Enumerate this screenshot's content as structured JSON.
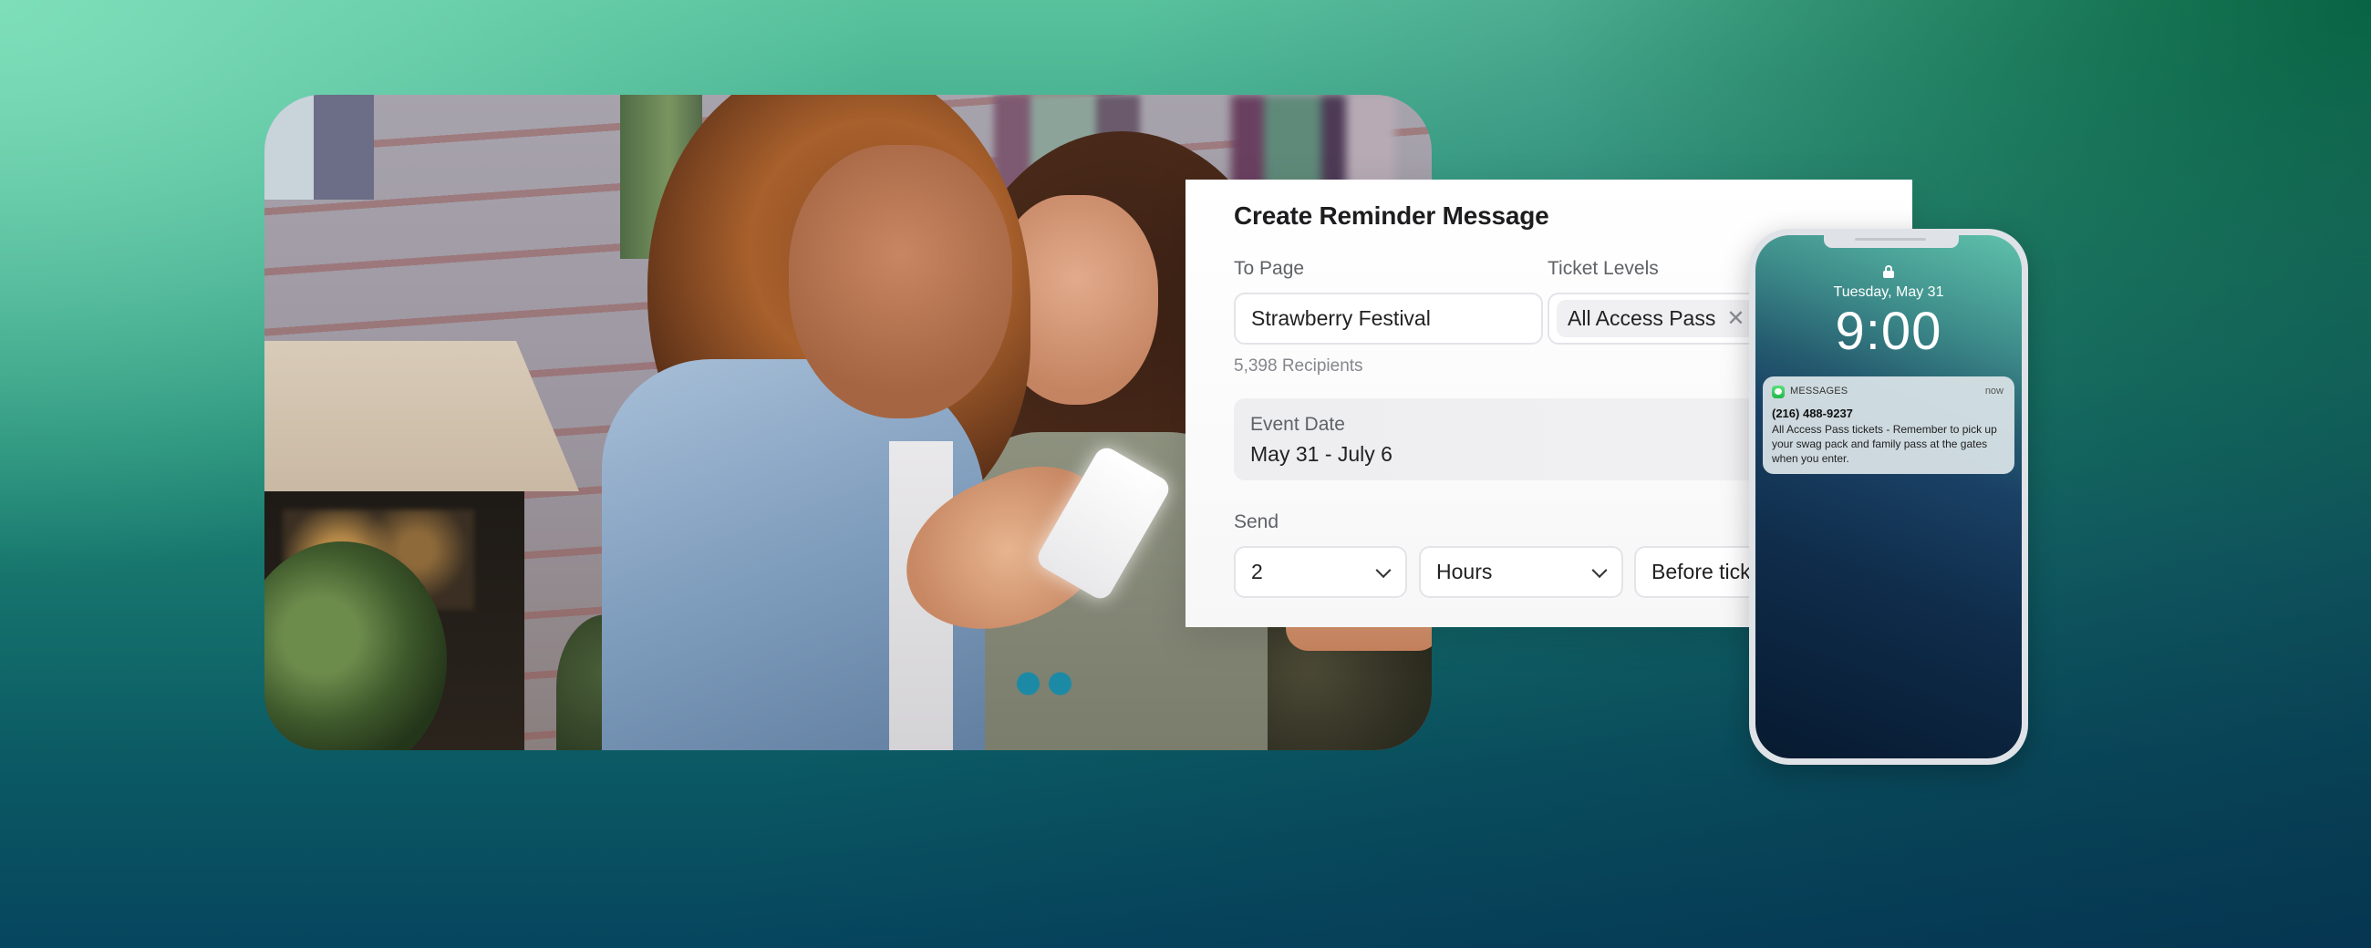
{
  "colors": {
    "bg_top_left": "#7EDEBA",
    "bg_top_right": "#0A8C42",
    "bg_bottom_left": "#0B5A64",
    "bg_bottom_right": "#06344E",
    "card_bg": "#FFFFFF",
    "messages_green": "#21B84A"
  },
  "photo": {
    "description": "Two smiling women looking at a smartphone outside a brick building"
  },
  "form": {
    "title": "Create Reminder Message",
    "to_page": {
      "label": "To Page",
      "value": "Strawberry Festival"
    },
    "ticket_levels": {
      "label": "Ticket Levels",
      "chips": [
        {
          "label": "All Access Pass",
          "remove_icon": "close-icon"
        }
      ]
    },
    "recipients": "5,398 Recipients",
    "event_date": {
      "label": "Event Date",
      "value": "May 31 - July 6"
    },
    "send": {
      "label": "Send",
      "amount": "2",
      "unit": "Hours",
      "timing": "Before tick"
    }
  },
  "phone": {
    "lock_icon": "lock-icon",
    "date": "Tuesday, May 31",
    "time": "9:00",
    "notification": {
      "app": "MESSAGES",
      "when": "now",
      "sender": "(216) 488-9237",
      "body": "All Access Pass tickets - Remember to pick up your swag pack and family pass at the gates when you enter."
    }
  }
}
